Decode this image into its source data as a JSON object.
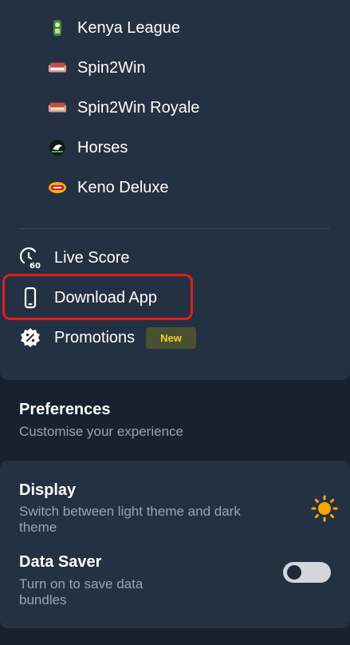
{
  "games": [
    {
      "label": "Kenya League",
      "icon": "kenya-league-icon"
    },
    {
      "label": "Spin2Win",
      "icon": "spin2win-icon"
    },
    {
      "label": "Spin2Win Royale",
      "icon": "spin2win-royale-icon"
    },
    {
      "label": "Horses",
      "icon": "horses-icon"
    },
    {
      "label": "Keno Deluxe",
      "icon": "keno-deluxe-icon"
    }
  ],
  "menu": {
    "live_score": {
      "label": "Live Score",
      "icon_text": "60"
    },
    "download_app": {
      "label": "Download App"
    },
    "promotions": {
      "label": "Promotions",
      "badge": "New"
    }
  },
  "preferences": {
    "title": "Preferences",
    "subtitle": "Customise your experience"
  },
  "display": {
    "title": "Display",
    "description": "Switch between light theme and dark theme",
    "theme_icon": "sun-icon"
  },
  "data_saver": {
    "title": "Data Saver",
    "description": "Turn on to save data bundles",
    "enabled": false
  },
  "colors": {
    "background": "#172130",
    "panel": "#243142",
    "highlight": "#e01e1e",
    "badge_text": "#f2d22a",
    "sun": "#f5a800"
  }
}
